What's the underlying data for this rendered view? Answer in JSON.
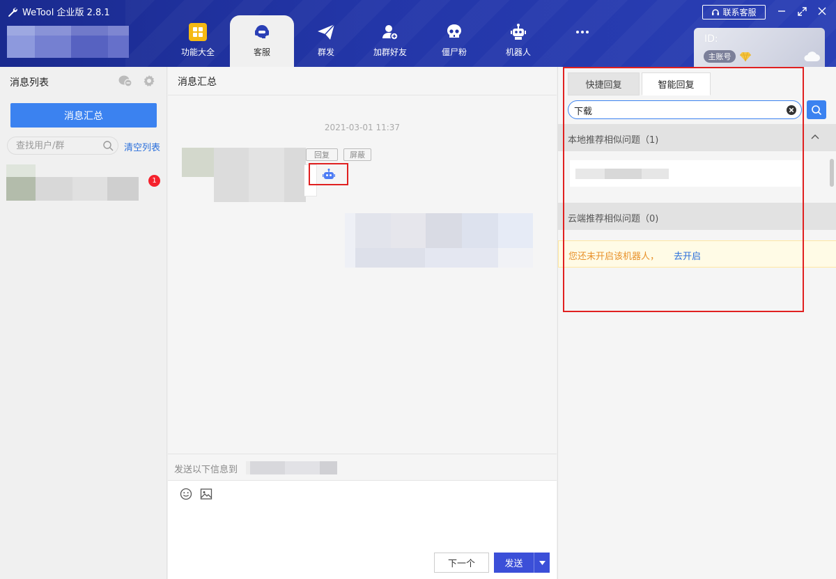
{
  "app": {
    "title": "WeTool 企业版 2.8.1"
  },
  "nav": [
    {
      "label": "功能大全",
      "icon": "grid-icon"
    },
    {
      "label": "客服",
      "icon": "headset-icon",
      "active": true
    },
    {
      "label": "群发",
      "icon": "paper-plane-icon"
    },
    {
      "label": "加群好友",
      "icon": "add-friend-icon"
    },
    {
      "label": "僵尸粉",
      "icon": "skull-icon"
    },
    {
      "label": "机器人",
      "icon": "robot-icon"
    },
    {
      "label": "",
      "icon": "more-dots-icon"
    }
  ],
  "header": {
    "contact_label": "联系客服"
  },
  "account": {
    "id_label": "ID:",
    "badge": "主账号"
  },
  "left": {
    "title": "消息列表",
    "summary_button": "消息汇总",
    "search_placeholder": "查找用户/群",
    "clear_link": "清空列表",
    "unread_count": "1"
  },
  "middle": {
    "title": "消息汇总",
    "timestamp": "2021-03-01 11:37",
    "reply_tag": "回复",
    "block_tag": "屏蔽",
    "send_to_label": "发送以下信息到",
    "next_button": "下一个",
    "send_button": "发送"
  },
  "right": {
    "tabs": [
      "快捷回复",
      "智能回复"
    ],
    "search_value": "下载",
    "local_section": "本地推荐相似问题（1)",
    "cloud_section": "云端推荐相似问题（0)",
    "notice_text": "您还未开启该机器人，",
    "notice_link": "去开启"
  },
  "colors": {
    "primary": "#3b82f0",
    "nav_bg": "#2336a8",
    "send": "#3b4fd8",
    "highlight": "#e02020",
    "warning": "#e8912a"
  }
}
